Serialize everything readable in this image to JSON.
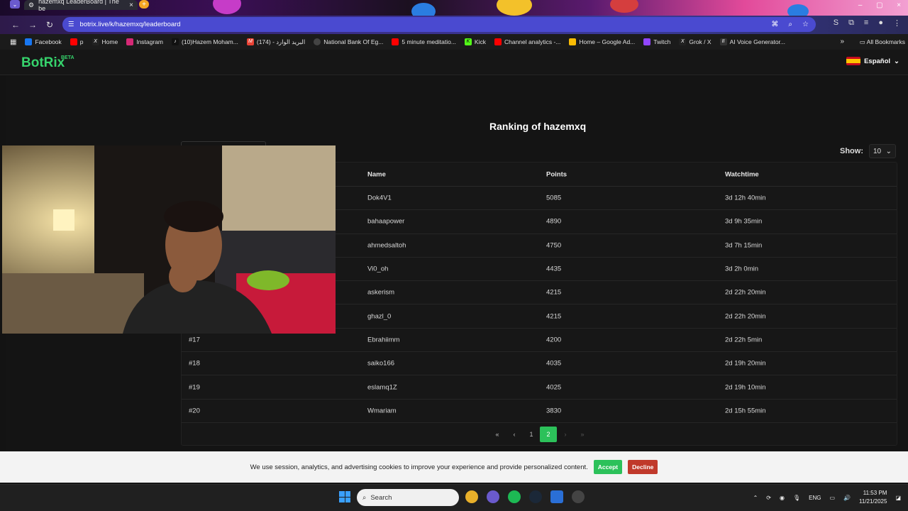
{
  "browser": {
    "tab_title": "hazemxq LeaderBoard | The be",
    "url": "botrix.live/k/hazemxq/leaderboard",
    "bookmarks": [
      {
        "label": "Facebook",
        "icon": "facebook-icon",
        "color": "#1877f2"
      },
      {
        "label": "p",
        "icon": "youtube-icon",
        "color": "#ff0000"
      },
      {
        "label": "Home",
        "icon": "x-icon",
        "color": "#222222"
      },
      {
        "label": "Instagram",
        "icon": "instagram-icon",
        "color": "#d62976"
      },
      {
        "label": "(10)Hazem Moham...",
        "icon": "tiktok-icon",
        "color": "#111111"
      },
      {
        "label": "(174) - البريد الوارد",
        "icon": "gmail-icon",
        "color": "#ea4335"
      },
      {
        "label": "National Bank Of Eg...",
        "icon": "globe-icon",
        "color": "#444444"
      },
      {
        "label": "5 minute meditatio...",
        "icon": "youtube-icon",
        "color": "#ff0000"
      },
      {
        "label": "Kick",
        "icon": "kick-icon",
        "color": "#53fc18"
      },
      {
        "label": "Channel analytics -...",
        "icon": "youtube-icon",
        "color": "#ff0000"
      },
      {
        "label": "Home – Google Ad...",
        "icon": "google-ads-icon",
        "color": "#fbbc04"
      },
      {
        "label": "Twitch",
        "icon": "twitch-icon",
        "color": "#9146ff"
      },
      {
        "label": "Grok / X",
        "icon": "x-icon",
        "color": "#222222"
      },
      {
        "label": "AI Voice Generator...",
        "icon": "elevenlabs-icon",
        "color": "#333333"
      }
    ],
    "all_bookmarks": "All Bookmarks"
  },
  "site": {
    "logo": "BotRix",
    "logo_badge": "BETA",
    "language": "Español",
    "heading": "Ranking of hazemxq",
    "show_label": "Show:",
    "show_value": "10",
    "columns": {
      "rank": "",
      "name": "Name",
      "points": "Points",
      "watchtime": "Watchtime"
    },
    "rows": [
      {
        "rank": "",
        "name": "Dok4V1",
        "points": "5085",
        "watchtime": "3d 12h 40min"
      },
      {
        "rank": "",
        "name": "bahaapower",
        "points": "4890",
        "watchtime": "3d 9h 35min"
      },
      {
        "rank": "",
        "name": "ahmedsaltoh",
        "points": "4750",
        "watchtime": "3d 7h 15min"
      },
      {
        "rank": "",
        "name": "Vi0_oh",
        "points": "4435",
        "watchtime": "3d 2h 0min"
      },
      {
        "rank": "",
        "name": "askerism",
        "points": "4215",
        "watchtime": "2d 22h 20min"
      },
      {
        "rank": "",
        "name": "ghazl_0",
        "points": "4215",
        "watchtime": "2d 22h 20min"
      },
      {
        "rank": "#17",
        "name": "Ebrahiimm",
        "points": "4200",
        "watchtime": "2d 22h 5min"
      },
      {
        "rank": "#18",
        "name": "saiko166",
        "points": "4035",
        "watchtime": "2d 19h 20min"
      },
      {
        "rank": "#19",
        "name": "eslamq1Z",
        "points": "4025",
        "watchtime": "2d 19h 10min"
      },
      {
        "rank": "#20",
        "name": "Wmariam",
        "points": "3830",
        "watchtime": "2d 15h 55min"
      }
    ],
    "pager": {
      "first": "«",
      "prev": "‹",
      "pages": [
        "1",
        "2"
      ],
      "current": "2",
      "next": "›",
      "last": "»"
    }
  },
  "cookie": {
    "text": "We use session, analytics, and advertising cookies to improve your experience and provide personalized content.",
    "accept": "Accept",
    "decline": "Decline"
  },
  "taskbar": {
    "search_placeholder": "Search",
    "language": "ENG",
    "time": "11:53 PM",
    "date": "11/21/2025"
  }
}
